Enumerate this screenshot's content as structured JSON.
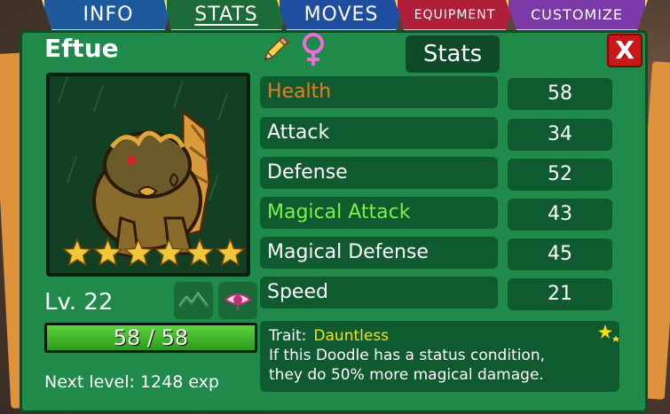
{
  "tabs": [
    {
      "label": "INFO"
    },
    {
      "label": "STATS"
    },
    {
      "label": "MOVES"
    },
    {
      "label": "EQUIPMENT"
    },
    {
      "label": "CUSTOMIZE"
    }
  ],
  "doodle": {
    "name": "Eftue",
    "level": "Lv. 22",
    "hp": "58 / 58",
    "hp_fraction": 1.0,
    "next_level": "Next level: 1248 exp",
    "stars": 6
  },
  "header": {
    "title": "Stats",
    "close_label": "X"
  },
  "stats": [
    {
      "label": "Health",
      "value": "58",
      "color": "#f07a1e"
    },
    {
      "label": "Attack",
      "value": "34",
      "color": "#ffffff"
    },
    {
      "label": "Defense",
      "value": "52",
      "color": "#ffffff"
    },
    {
      "label": "Magical Attack",
      "value": "43",
      "color": "#7ef04a"
    },
    {
      "label": "Magical Defense",
      "value": "45",
      "color": "#ffffff"
    },
    {
      "label": "Speed",
      "value": "21",
      "color": "#ffffff"
    }
  ],
  "trait": {
    "prefix": "Trait:",
    "name": "Dauntless",
    "description_1": "If this Doodle has a status condition,",
    "description_2": "they do 50% more magical damage."
  },
  "colors": {
    "panel": "#1f8a4a",
    "row_bg": "#0f5a2e",
    "trait_name": "#f4e11c",
    "star": "#f2c63a",
    "close": "#c81818"
  },
  "icons": [
    "pencil-icon",
    "female-icon",
    "mountain-icon",
    "eye-icon",
    "sparkle-icon",
    "star-icon"
  ]
}
